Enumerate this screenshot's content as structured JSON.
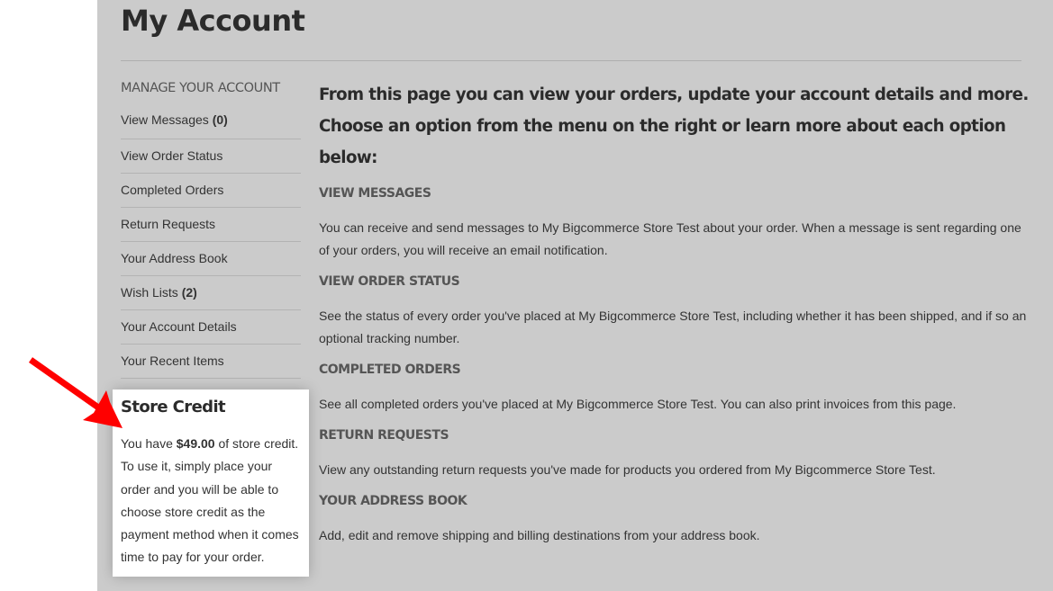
{
  "page": {
    "title": "My Account"
  },
  "sidebar": {
    "heading": "MANAGE YOUR ACCOUNT",
    "items": [
      {
        "label": "View Messages",
        "count": "(0)"
      },
      {
        "label": "View Order Status"
      },
      {
        "label": "Completed Orders"
      },
      {
        "label": "Return Requests"
      },
      {
        "label": "Your Address Book"
      },
      {
        "label": "Wish Lists",
        "count": "(2)"
      },
      {
        "label": "Your Account Details"
      },
      {
        "label": "Your Recent Items"
      }
    ]
  },
  "store_credit": {
    "title": "Store Credit",
    "text_before": "You have ",
    "amount": "$49.00",
    "text_after": " of store credit. To use it, simply place your order and you will be able to choose store credit as the payment method when it comes time to pay for your order."
  },
  "content": {
    "intro": "From this page you can view your orders, update your account details and more. Choose an option from the menu on the right or learn more about each option below:",
    "sections": [
      {
        "title": "VIEW MESSAGES",
        "text": "You can receive and send messages to My Bigcommerce Store Test about your order. When a message is sent regarding one of your orders, you will receive an email notification."
      },
      {
        "title": "VIEW ORDER STATUS",
        "text": "See the status of every order you've placed at My Bigcommerce Store Test, including whether it has been shipped, and if so an optional tracking number."
      },
      {
        "title": "COMPLETED ORDERS",
        "text": "See all completed orders you've placed at My Bigcommerce Store Test. You can also print invoices from this page."
      },
      {
        "title": "RETURN REQUESTS",
        "text": "View any outstanding return requests you've made for products you ordered from My Bigcommerce Store Test."
      },
      {
        "title": "YOUR ADDRESS BOOK",
        "text": "Add, edit and remove shipping and billing destinations from your address book."
      }
    ]
  },
  "annotation": {
    "arrow_color": "#ff0000",
    "icon": "red-arrow-pointing-to-store-credit"
  }
}
